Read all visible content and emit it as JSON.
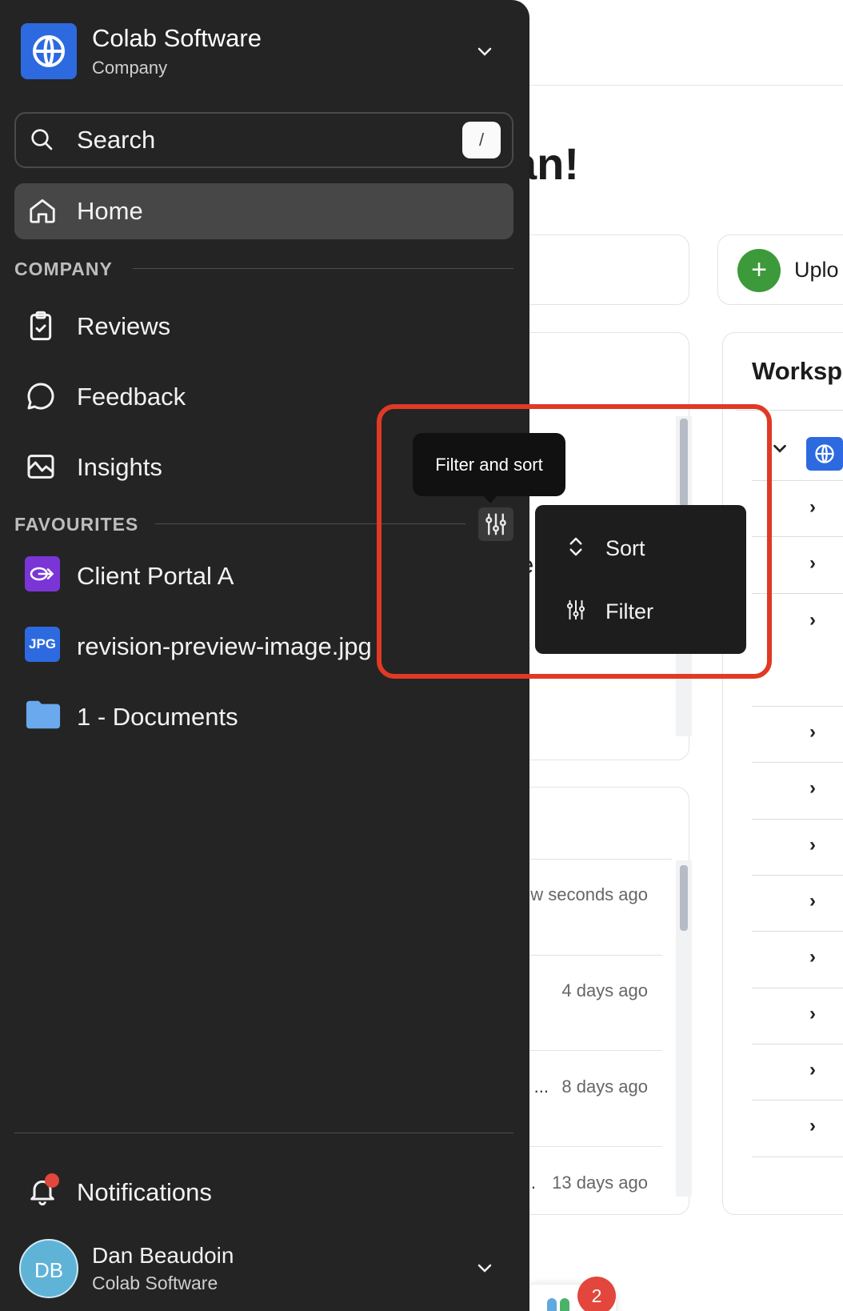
{
  "background": {
    "greeting_fragment": "an!",
    "upload_label": "Uplo",
    "workspace_title": "Worksp",
    "partial_row_text": "e",
    "activity_times": [
      "w seconds ago",
      "4 days ago",
      "8 days ago",
      "13 days ago"
    ],
    "activity_prefix_3": "...",
    "activity_prefix_4": ".",
    "bottom_badge_count": "2"
  },
  "sidebar": {
    "company_name": "Colab Software",
    "company_type": "Company",
    "search_placeholder": "Search",
    "search_shortcut": "/",
    "home_label": "Home",
    "company_section": "COMPANY",
    "nav_items": [
      "Reviews",
      "Feedback",
      "Insights"
    ],
    "favourites_section": "FAVOURITES",
    "favourites": [
      "Client Portal A",
      "revision-preview-image.jpg",
      "1 - Documents"
    ],
    "jpg_badge": "JPG",
    "notifications_label": "Notifications",
    "user_initials": "DB",
    "user_name": "Dan Beaudoin",
    "user_org": "Colab Software"
  },
  "popover": {
    "tooltip": "Filter and sort",
    "menu_items": [
      "Sort",
      "Filter"
    ]
  },
  "colors": {
    "sidebar_bg": "#242424",
    "accent_blue": "#2d6ae0",
    "highlight_red": "#e03a24",
    "upload_green": "#3d9a3a",
    "notification_red": "#e2463c"
  }
}
